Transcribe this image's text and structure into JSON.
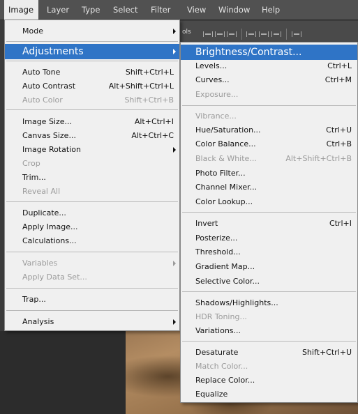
{
  "menubar": {
    "items": [
      "Image",
      "Layer",
      "Type",
      "Select",
      "Filter",
      "View",
      "Window",
      "Help"
    ],
    "active": "Image"
  },
  "options_bar": {
    "label": "ols"
  },
  "image_menu": {
    "items": [
      {
        "label": "Mode",
        "shortcut": "",
        "submenu": true,
        "disabled": false
      },
      {
        "label": "Adjustments",
        "shortcut": "",
        "submenu": true,
        "disabled": false,
        "highlighted": true
      },
      {
        "label": "Auto Tone",
        "shortcut": "Shift+Ctrl+L",
        "disabled": false
      },
      {
        "label": "Auto Contrast",
        "shortcut": "Alt+Shift+Ctrl+L",
        "disabled": false
      },
      {
        "label": "Auto Color",
        "shortcut": "Shift+Ctrl+B",
        "disabled": true
      },
      {
        "label": "Image Size...",
        "shortcut": "Alt+Ctrl+I",
        "disabled": false
      },
      {
        "label": "Canvas Size...",
        "shortcut": "Alt+Ctrl+C",
        "disabled": false
      },
      {
        "label": "Image Rotation",
        "shortcut": "",
        "submenu": true,
        "disabled": false
      },
      {
        "label": "Crop",
        "shortcut": "",
        "disabled": true
      },
      {
        "label": "Trim...",
        "shortcut": "",
        "disabled": false
      },
      {
        "label": "Reveal All",
        "shortcut": "",
        "disabled": true
      },
      {
        "label": "Duplicate...",
        "shortcut": "",
        "disabled": false
      },
      {
        "label": "Apply Image...",
        "shortcut": "",
        "disabled": false
      },
      {
        "label": "Calculations...",
        "shortcut": "",
        "disabled": false
      },
      {
        "label": "Variables",
        "shortcut": "",
        "submenu": true,
        "disabled": true
      },
      {
        "label": "Apply Data Set...",
        "shortcut": "",
        "disabled": true
      },
      {
        "label": "Trap...",
        "shortcut": "",
        "disabled": false
      },
      {
        "label": "Analysis",
        "shortcut": "",
        "submenu": true,
        "disabled": false
      }
    ]
  },
  "adjustments_menu": {
    "items": [
      {
        "label": "Brightness/Contrast...",
        "shortcut": "",
        "disabled": false,
        "highlighted": true
      },
      {
        "label": "Levels...",
        "shortcut": "Ctrl+L",
        "disabled": false
      },
      {
        "label": "Curves...",
        "shortcut": "Ctrl+M",
        "disabled": false
      },
      {
        "label": "Exposure...",
        "shortcut": "",
        "disabled": true
      },
      {
        "label": "Vibrance...",
        "shortcut": "",
        "disabled": true
      },
      {
        "label": "Hue/Saturation...",
        "shortcut": "Ctrl+U",
        "disabled": false
      },
      {
        "label": "Color Balance...",
        "shortcut": "Ctrl+B",
        "disabled": false
      },
      {
        "label": "Black & White...",
        "shortcut": "Alt+Shift+Ctrl+B",
        "disabled": true
      },
      {
        "label": "Photo Filter...",
        "shortcut": "",
        "disabled": false
      },
      {
        "label": "Channel Mixer...",
        "shortcut": "",
        "disabled": false
      },
      {
        "label": "Color Lookup...",
        "shortcut": "",
        "disabled": false
      },
      {
        "label": "Invert",
        "shortcut": "Ctrl+I",
        "disabled": false
      },
      {
        "label": "Posterize...",
        "shortcut": "",
        "disabled": false
      },
      {
        "label": "Threshold...",
        "shortcut": "",
        "disabled": false
      },
      {
        "label": "Gradient Map...",
        "shortcut": "",
        "disabled": false
      },
      {
        "label": "Selective Color...",
        "shortcut": "",
        "disabled": false
      },
      {
        "label": "Shadows/Highlights...",
        "shortcut": "",
        "disabled": false
      },
      {
        "label": "HDR Toning...",
        "shortcut": "",
        "disabled": true
      },
      {
        "label": "Variations...",
        "shortcut": "",
        "disabled": false
      },
      {
        "label": "Desaturate",
        "shortcut": "Shift+Ctrl+U",
        "disabled": false
      },
      {
        "label": "Match Color...",
        "shortcut": "",
        "disabled": true
      },
      {
        "label": "Replace Color...",
        "shortcut": "",
        "disabled": false
      },
      {
        "label": "Equalize",
        "shortcut": "",
        "disabled": false
      }
    ]
  },
  "colors": {
    "highlight": "#2f74c6",
    "menu_bg": "#f0f0f0",
    "menubar_bg": "#515151"
  }
}
